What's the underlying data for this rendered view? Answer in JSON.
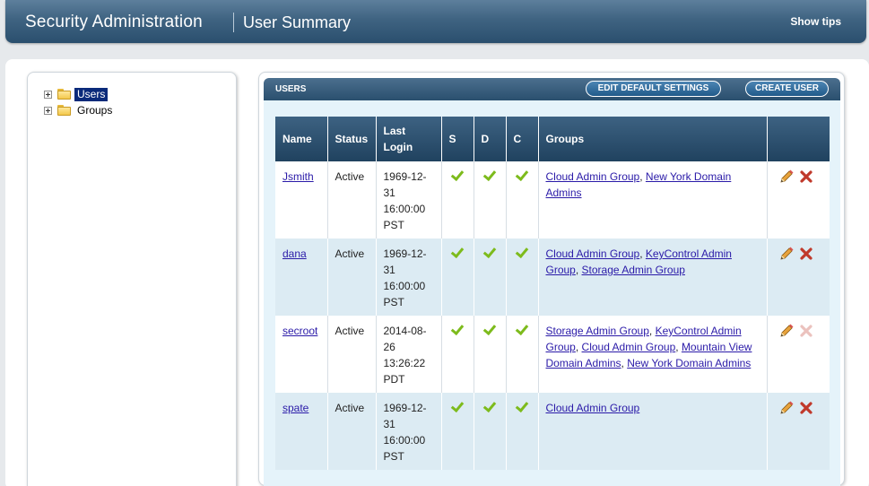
{
  "header": {
    "app_title": "Security Administration",
    "page_title": "User Summary",
    "tips_label": "Show tips"
  },
  "tree": {
    "items": [
      {
        "label": "Users",
        "selected": true,
        "icon": "folder-icon"
      },
      {
        "label": "Groups",
        "selected": false,
        "icon": "folder-icon"
      }
    ]
  },
  "users_panel": {
    "title": "USERS",
    "edit_defaults_label": "EDIT DEFAULT SETTINGS",
    "create_user_label": "CREATE USER"
  },
  "table": {
    "columns": [
      "Name",
      "Status",
      "Last Login",
      "S",
      "D",
      "C",
      "Groups",
      ""
    ],
    "rows": [
      {
        "name": "Jsmith",
        "status": "Active",
        "last_login": "1969-12-31 16:00:00 PST",
        "s": true,
        "d": true,
        "c": true,
        "groups": [
          "Cloud Admin Group",
          "New York Domain Admins"
        ],
        "delete_enabled": true
      },
      {
        "name": "dana",
        "status": "Active",
        "last_login": "1969-12-31 16:00:00 PST",
        "s": true,
        "d": true,
        "c": true,
        "groups": [
          "Cloud Admin Group",
          "KeyControl Admin Group",
          "Storage Admin Group"
        ],
        "delete_enabled": true
      },
      {
        "name": "secroot",
        "status": "Active",
        "last_login": "2014-08-26 13:26:22 PDT",
        "s": true,
        "d": true,
        "c": true,
        "groups": [
          "Storage Admin Group",
          "KeyControl Admin Group",
          "Cloud Admin Group",
          "Mountain View Domain Admins",
          "New York Domain Admins"
        ],
        "delete_enabled": false
      },
      {
        "name": "spate",
        "status": "Active",
        "last_login": "1969-12-31 16:00:00 PST",
        "s": true,
        "d": true,
        "c": true,
        "groups": [
          "Cloud Admin Group"
        ],
        "delete_enabled": true
      }
    ]
  },
  "colors": {
    "header_dark": "#2a4f6e",
    "link": "#2a1aa8",
    "check_green": "#7dbb1c",
    "delete_red": "#c0392b",
    "row_alt": "#dcebf3"
  }
}
